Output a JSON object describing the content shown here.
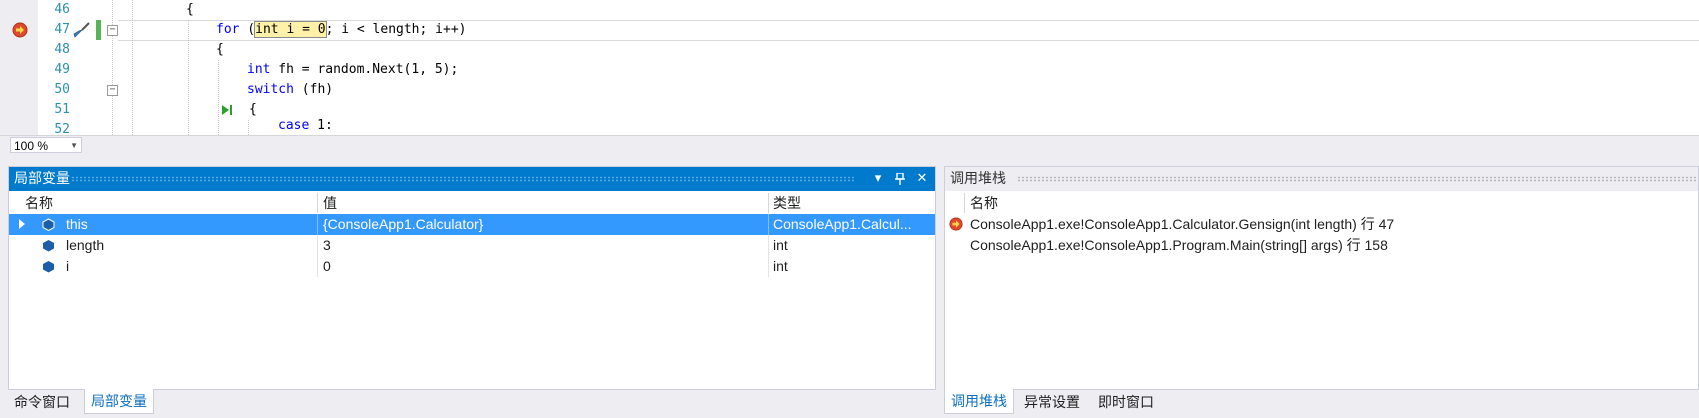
{
  "editor": {
    "lines": [
      {
        "num": "46",
        "code": "{"
      },
      {
        "num": "47",
        "code_kw": "for",
        "code_rest": " (",
        "code_hl": "int i = 0",
        "code_tail": "; i < length; i++)"
      },
      {
        "num": "48",
        "code": "{"
      },
      {
        "num": "49",
        "code_kw": "int",
        "code_tail": " fh = random.Next(1, 5);"
      },
      {
        "num": "50",
        "code_kw": "switch",
        "code_tail": " (fh)"
      },
      {
        "num": "51",
        "code": "{"
      },
      {
        "num": "52",
        "code_kw": "case",
        "code_tail": " 1:"
      }
    ],
    "zoom": "100 %"
  },
  "locals": {
    "title": "局部变量",
    "columns": {
      "name": "名称",
      "value": "值",
      "type": "类型"
    },
    "rows": [
      {
        "name": "this",
        "value": "{ConsoleApp1.Calculator}",
        "type": "ConsoleApp1.Calcul..."
      },
      {
        "name": "length",
        "value": "3",
        "type": "int"
      },
      {
        "name": "i",
        "value": "0",
        "type": "int"
      }
    ]
  },
  "callstack": {
    "title": "调用堆栈",
    "columns": {
      "name": "名称"
    },
    "rows": [
      {
        "name": "ConsoleApp1.exe!ConsoleApp1.Calculator.Gensign(int length) 行 47"
      },
      {
        "name": "ConsoleApp1.exe!ConsoleApp1.Program.Main(string[] args) 行 158"
      }
    ]
  },
  "left_tabs": [
    "命令窗口",
    "局部变量"
  ],
  "right_tabs": [
    "调用堆栈",
    "异常设置",
    "即时窗口"
  ],
  "colors": {
    "accent": "#007acc",
    "selection": "#3399ff",
    "keyword": "#0000ff",
    "line_number": "#2b91af"
  }
}
